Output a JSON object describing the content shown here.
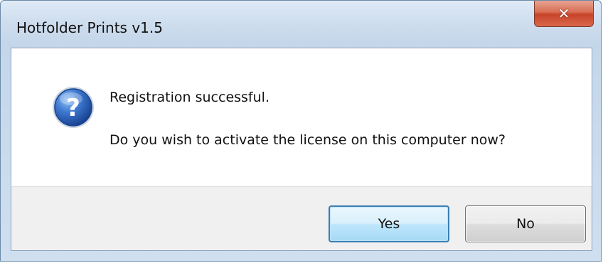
{
  "window": {
    "title": "Hotfolder Prints v1.5",
    "close_icon": "close-icon"
  },
  "dialog": {
    "icon": "question-icon",
    "message_line1": "Registration successful.",
    "message_line2": "Do you wish to activate the license on this computer now?"
  },
  "buttons": {
    "yes_label": "Yes",
    "no_label": "No"
  },
  "colors": {
    "close_button": "#c8442a",
    "question_icon": "#2a5fb0",
    "default_button_border": "#3c7fb1"
  }
}
